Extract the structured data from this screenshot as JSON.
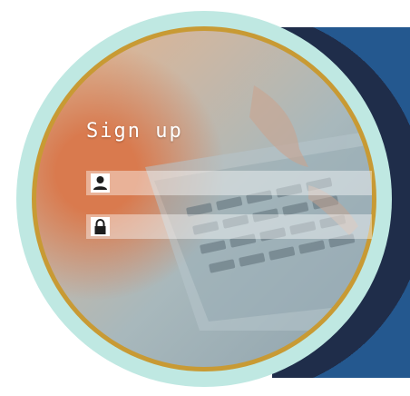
{
  "form": {
    "title": "Sign up",
    "fields": [
      {
        "icon": "user-icon",
        "value": ""
      },
      {
        "icon": "lock-icon",
        "value": ""
      }
    ]
  },
  "colors": {
    "outer_ring": "#bfe8e2",
    "gold_ring": "#c89a34",
    "dark_panel": "#1f2d4a",
    "blue_panel": "#24588f"
  }
}
